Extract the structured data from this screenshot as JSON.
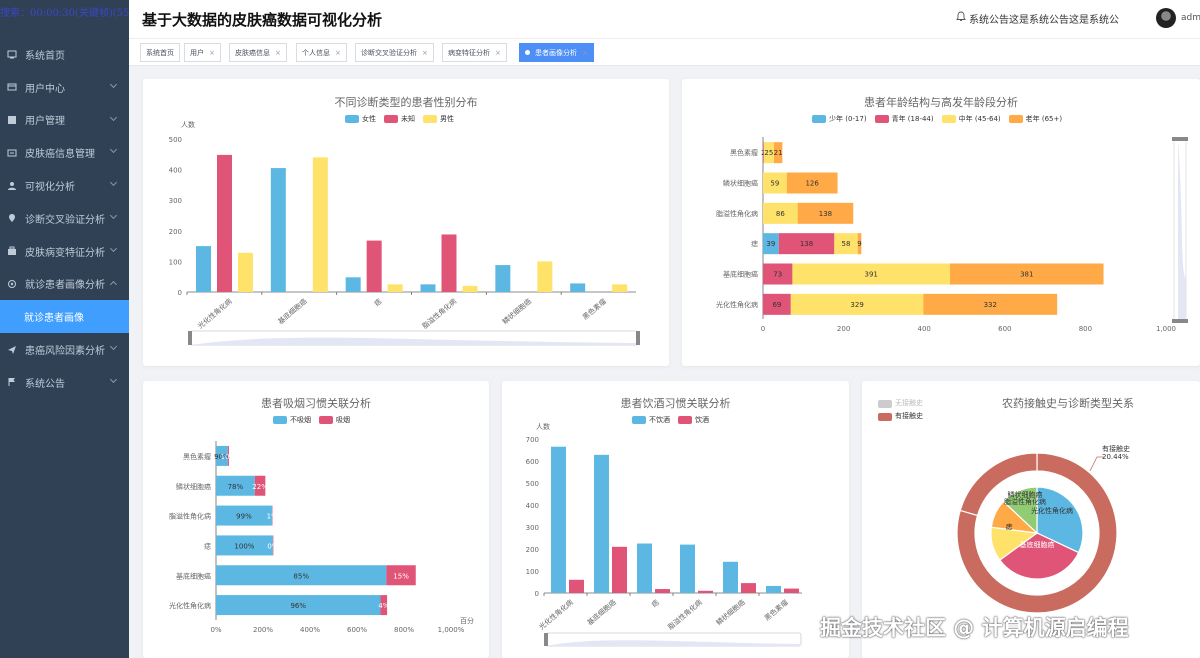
{
  "app": {
    "search_banner": "搜索：00:00:30(关键帧)(55)",
    "page_title": "基于大数据的皮肤癌数据可视化分析",
    "notice": "系统公告这是系统公告这是系统公",
    "username": "adm"
  },
  "sidebar": {
    "items": [
      {
        "label": "系统首页",
        "icon": "home-icon",
        "chev": ""
      },
      {
        "label": "用户中心",
        "icon": "user-center-icon",
        "chev": "down"
      },
      {
        "label": "用户管理",
        "icon": "user-manage-icon",
        "chev": "down"
      },
      {
        "label": "皮肤癌信息管理",
        "icon": "info-icon",
        "chev": "down"
      },
      {
        "label": "可视化分析",
        "icon": "person-icon",
        "chev": "down"
      },
      {
        "label": "诊断交叉验证分析",
        "icon": "location-icon",
        "chev": "down"
      },
      {
        "label": "皮肤病变特征分析",
        "icon": "suitcase-icon",
        "chev": "down"
      },
      {
        "label": "就诊患者画像分析",
        "icon": "settings-icon",
        "chev": "up"
      },
      {
        "label": "就诊患者画像",
        "icon": "",
        "chev": "",
        "active": true
      },
      {
        "label": "患癌风险因素分析",
        "icon": "send-icon",
        "chev": "down"
      },
      {
        "label": "系统公告",
        "icon": "flag-icon",
        "chev": "down"
      }
    ]
  },
  "tabs": [
    {
      "label": "系统首页",
      "closable": false
    },
    {
      "label": "用户",
      "closable": true
    },
    {
      "label": "皮肤癌信息",
      "closable": true
    },
    {
      "label": "个人信息",
      "closable": true
    },
    {
      "label": "诊断交叉验证分析",
      "closable": true
    },
    {
      "label": "病变特征分析",
      "closable": true
    },
    {
      "label": "患者画像分析",
      "closable": true,
      "active": true
    }
  ],
  "colors": {
    "blue": "#5cb8e2",
    "red": "#e05477",
    "yellow": "#ffe26a",
    "orange": "#ffaa47",
    "brown": "#c96b5f",
    "sidebar": "#304156",
    "accent": "#409eff"
  },
  "chart_data": [
    {
      "type": "bar",
      "title": "不同诊断类型的患者性别分布",
      "ylabel": "人数",
      "ylim": [
        0,
        500
      ],
      "yticks": [
        "0",
        "100",
        "200",
        "300",
        "400",
        "500"
      ],
      "categories": [
        "光化性角化病",
        "基底细胞癌",
        "痣",
        "脂溢性角化病",
        "鳞状细胞癌",
        "黑色素瘤"
      ],
      "series": [
        {
          "name": "女性",
          "values": [
            150,
            405,
            48,
            25,
            88,
            28
          ]
        },
        {
          "name": "未知",
          "values": [
            448,
            0,
            168,
            188,
            0,
            0
          ]
        },
        {
          "name": "男性",
          "values": [
            128,
            440,
            25,
            20,
            100,
            25
          ]
        }
      ],
      "legend": "top"
    },
    {
      "type": "bar",
      "orientation": "horizontal-stacked",
      "title": "患者年龄结构与高发年龄段分析",
      "xlim": [
        0,
        1000
      ],
      "xticks": [
        "0",
        "200",
        "400",
        "600",
        "800",
        "1,000"
      ],
      "categories": [
        "黑色素瘤",
        "鳞状细胞癌",
        "脂溢性角化病",
        "痣",
        "基底细胞癌",
        "光化性角化病"
      ],
      "series": [
        {
          "name": "少年 (0-17)",
          "values": [
            0,
            0,
            0,
            39,
            0,
            0
          ]
        },
        {
          "name": "青年 (18-44)",
          "values": [
            2,
            0,
            0,
            138,
            73,
            69
          ]
        },
        {
          "name": "中年 (45-64)",
          "values": [
            25,
            59,
            86,
            58,
            391,
            329
          ]
        },
        {
          "name": "老年 (65+)",
          "values": [
            21,
            126,
            138,
            9,
            381,
            332
          ]
        }
      ],
      "labels": [
        [
          "",
          "2",
          "25",
          "21"
        ],
        [
          "0",
          "",
          "59",
          "126"
        ],
        [
          "0",
          "",
          "86",
          "138"
        ],
        [
          "39",
          "138",
          "58",
          "9"
        ],
        [
          "0",
          "73",
          "391",
          "381"
        ],
        [
          "0",
          "69",
          "329",
          "332"
        ]
      ],
      "legend": "top"
    },
    {
      "type": "bar",
      "orientation": "horizontal-stacked",
      "title": "患者吸烟习惯关联分析",
      "xlabel": "百分",
      "xlim": [
        0,
        1000
      ],
      "xticks": [
        "0%",
        "200%",
        "400%",
        "600%",
        "800%",
        "1,000%"
      ],
      "categories": [
        "黑色素瘤",
        "鳞状细胞癌",
        "脂溢性角化病",
        "痣",
        "基底细胞癌",
        "光化性角化病"
      ],
      "series": [
        {
          "name": "不吸烟",
          "values": [
            50,
            165,
            238,
            242,
            725,
            700
          ]
        },
        {
          "name": "吸烟",
          "values": [
            5,
            45,
            2,
            1,
            125,
            28
          ]
        }
      ],
      "labels": [
        [
          "90%",
          "10%"
        ],
        [
          "78%",
          "22%"
        ],
        [
          "99%",
          "1%"
        ],
        [
          "100%",
          "0%"
        ],
        [
          "85%",
          "15%"
        ],
        [
          "96%",
          "4%"
        ]
      ],
      "legend": "top"
    },
    {
      "type": "bar",
      "title": "患者饮酒习惯关联分析",
      "ylabel": "人数",
      "ylim": [
        0,
        700
      ],
      "yticks": [
        "0",
        "100",
        "200",
        "300",
        "400",
        "500",
        "600",
        "700"
      ],
      "categories": [
        "光化性角化病",
        "基底细胞癌",
        "痣",
        "脂溢性角化病",
        "鳞状细胞癌",
        "黑色素瘤"
      ],
      "series": [
        {
          "name": "不饮酒",
          "values": [
            665,
            628,
            225,
            220,
            142,
            32
          ]
        },
        {
          "name": "饮酒",
          "values": [
            60,
            210,
            18,
            10,
            45,
            20
          ]
        }
      ],
      "legend": "top"
    },
    {
      "type": "pie",
      "title": "农药接触史与诊断类型关系",
      "legend_items": [
        "无接触史",
        "有接触史"
      ],
      "outer": [
        {
          "name": "无接触史",
          "value": 79.56
        },
        {
          "name": "有接触史",
          "value": 20.44
        }
      ],
      "outer_label": "有接触史",
      "outer_label_value": "20.44%",
      "inner": [
        {
          "name": "光化性角化病",
          "value": 32
        },
        {
          "name": "基底细胞癌",
          "value": 33
        },
        {
          "name": "痣",
          "value": 12
        },
        {
          "name": "脂溢性角化病",
          "value": 10
        },
        {
          "name": "鳞状细胞癌",
          "value": 13
        }
      ]
    }
  ],
  "watermark": "掘金技术社区 @ 计算机源启编程"
}
